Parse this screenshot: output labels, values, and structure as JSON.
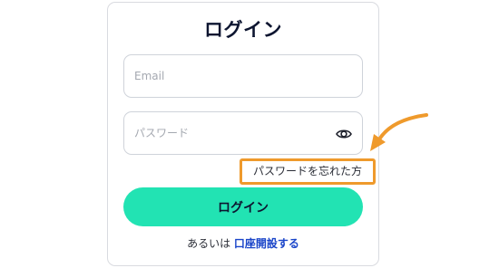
{
  "login": {
    "title": "ログイン",
    "email_placeholder": "Email",
    "password_placeholder": "パスワード",
    "forgot_password": "パスワードを忘れた方",
    "submit_label": "ログイン",
    "footer_prefix": "あるいは",
    "signup_link": "口座開設する"
  },
  "icons": {
    "password_toggle": "eye-icon",
    "annotation": "curved-arrow-icon"
  },
  "colors": {
    "primary_button": "#22e3b3",
    "highlight": "#ef9a2c",
    "link": "#1a45c9",
    "title": "#0d1530"
  }
}
